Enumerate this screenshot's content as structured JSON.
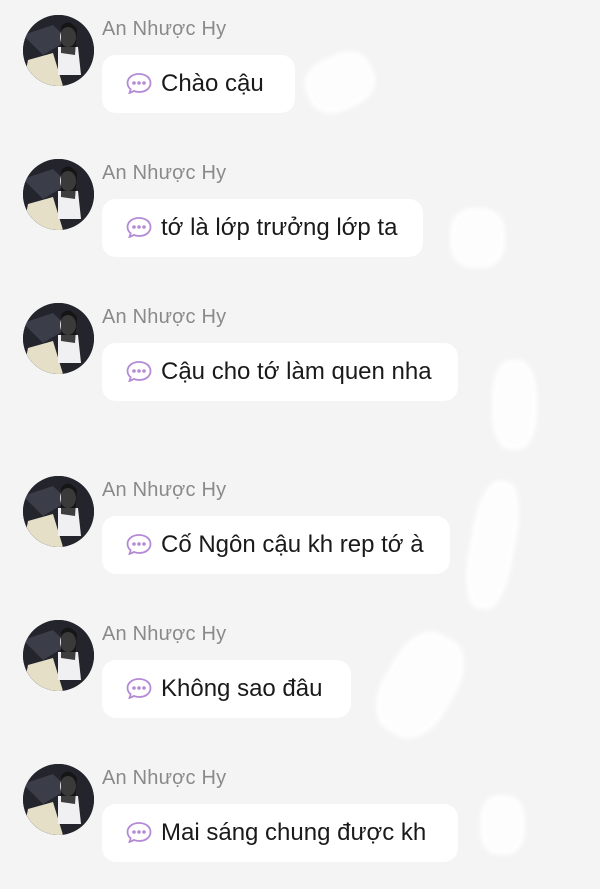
{
  "messages": [
    {
      "sender": "An Nhược Hy",
      "text": "Chào cậu"
    },
    {
      "sender": "An Nhược Hy",
      "text": "tớ là lớp trưởng lớp ta"
    },
    {
      "sender": "An Nhược Hy",
      "text": "Cậu cho tớ làm quen nha"
    },
    {
      "sender": "An Nhược Hy",
      "text": "Cố Ngôn cậu kh rep tớ à"
    },
    {
      "sender": "An Nhược Hy",
      "text": "Không sao đâu"
    },
    {
      "sender": "An Nhược Hy",
      "text": "Mai sáng chung được kh"
    }
  ],
  "icons": {
    "bubble_prefix": "speech-bubble-ellipsis-icon"
  },
  "colors": {
    "background": "#f4f4f4",
    "bubble": "#ffffff",
    "sender_name": "#8a8a8a",
    "message_text": "#1a1a1a",
    "bubble_icon": "#b48ad6"
  }
}
